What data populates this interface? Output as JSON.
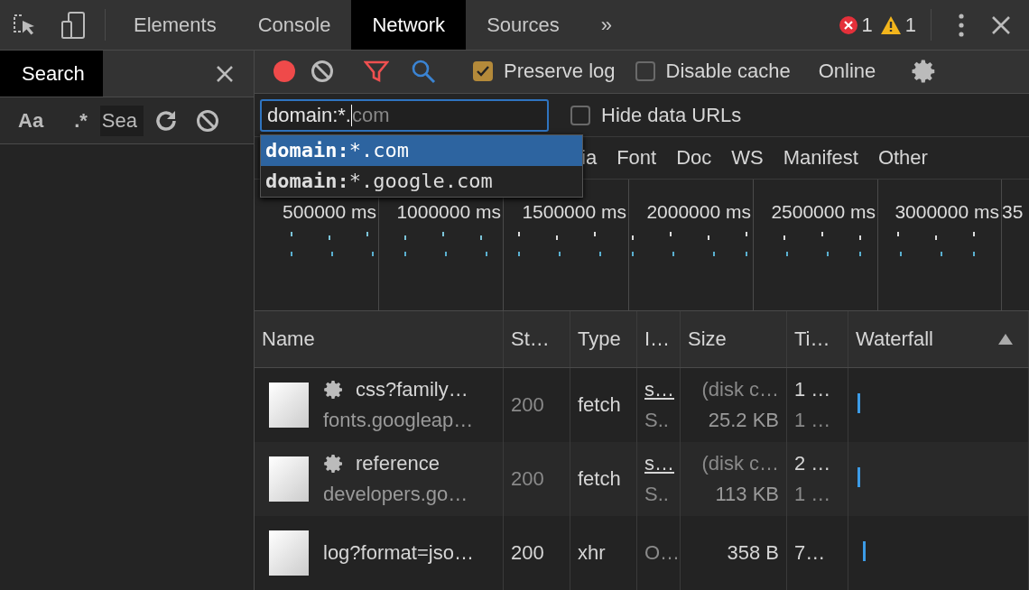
{
  "main_tabs": [
    {
      "label": "Elements",
      "selected": false
    },
    {
      "label": "Console",
      "selected": false
    },
    {
      "label": "Network",
      "selected": true
    },
    {
      "label": "Sources",
      "selected": false
    }
  ],
  "more_tabs": "»",
  "errors": "1",
  "warnings": "1",
  "drawer": {
    "tab": "Search",
    "options": [
      "Aa",
      ".*"
    ],
    "placeholder": "Sea"
  },
  "toolbar": {
    "recording": true,
    "preserve_log": {
      "label": "Preserve log",
      "checked": true
    },
    "disable_cache": {
      "label": "Disable cache",
      "checked": false
    },
    "throttle": "Online"
  },
  "filter": {
    "value": "domain:*.",
    "suggestion_rest": "com"
  },
  "hide_data_urls": {
    "label": "Hide data URLs",
    "checked": false
  },
  "suggestions": [
    {
      "key": "domain:",
      "rest": "*.com",
      "selected": true
    },
    {
      "key": "domain:",
      "rest": "*.google.com",
      "selected": false
    }
  ],
  "type_filters": [
    "ia",
    "Font",
    "Doc",
    "WS",
    "Manifest",
    "Other"
  ],
  "timeline_ticks": [
    "500000 ms",
    "1000000 ms",
    "1500000 ms",
    "2000000 ms",
    "2500000 ms",
    "3000000 ms",
    "35"
  ],
  "columns": [
    "Name",
    "St…",
    "Type",
    "I…",
    "Size",
    "Ti…",
    "Waterfall"
  ],
  "rows": [
    {
      "service_worker": true,
      "name": "css?family…",
      "domain": "fonts.googleap…",
      "status": "200",
      "cached": true,
      "type": "fetch",
      "initiator": "s…",
      "initiator_sub": "S..",
      "size": "(disk c…",
      "size_sub": "25.2 KB",
      "time": "1 …",
      "time_sub": "1 …"
    },
    {
      "service_worker": true,
      "name": "reference",
      "domain": "developers.go…",
      "status": "200",
      "cached": true,
      "type": "fetch",
      "initiator": "s…",
      "initiator_sub": "S..",
      "size": "(disk c…",
      "size_sub": "113 KB",
      "time": "2 …",
      "time_sub": "1 …"
    },
    {
      "service_worker": false,
      "name": "log?format=jso…",
      "status": "200",
      "cached": false,
      "type": "xhr",
      "initiator": "O…",
      "size": "358 B",
      "time": "7…"
    }
  ]
}
